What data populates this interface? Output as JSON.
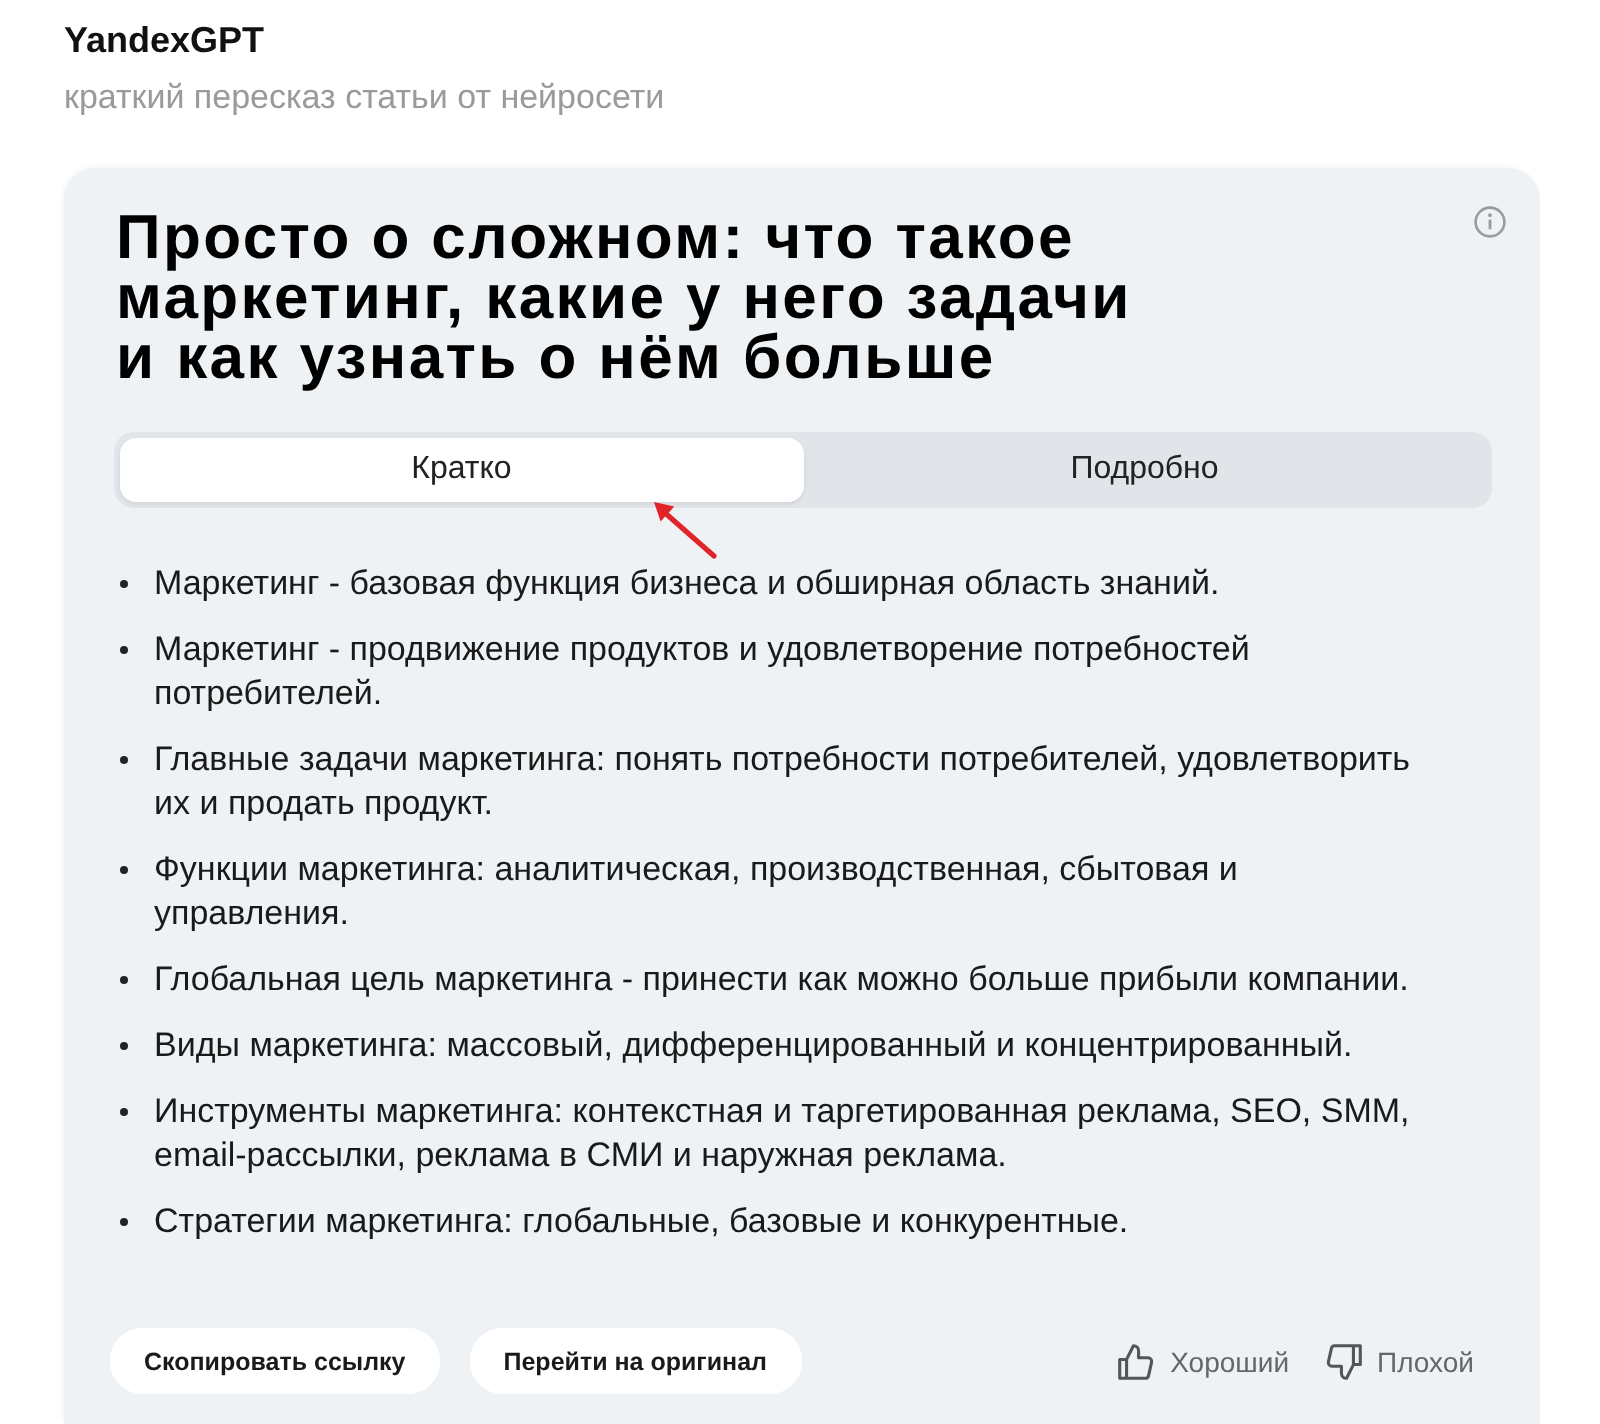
{
  "header": {
    "title": "YandexGPT",
    "subtitle": "краткий пересказ статьи от нейросети"
  },
  "card": {
    "title": "Просто о сложном: что такое маркетинг, какие у него задачи и как узнать о нём больше",
    "tabs": [
      {
        "label": "Кратко",
        "selected": true
      },
      {
        "label": "Подробно",
        "selected": false
      }
    ],
    "summary": [
      "Маркетинг - базовая функция бизнеса и обширная область знаний.",
      "Маркетинг - продвижение продуктов и удовлетворение потребностей потребителей.",
      "Главные задачи маркетинга: понять потребности потребителей, удовлетворить их и продать продукт.",
      "Функции маркетинга: аналитическая, производственная, сбытовая и управления.",
      "Глобальная цель маркетинга - принести как можно больше прибыли компании.",
      "Виды маркетинга: массовый, дифференцированный и концентрированный.",
      "Инструменты маркетинга: контекстная и таргетированная реклама, SEO, SMM, email-рассылки, реклама в СМИ и наружная реклама.",
      "Стратегии маркетинга: глобальные, базовые и конкурентные."
    ],
    "buttons": [
      "Скопировать ссылку",
      "Перейти на оригинал"
    ],
    "ratings": [
      {
        "kind": "like",
        "label": "Хороший"
      },
      {
        "kind": "dislike",
        "label": "Плохой"
      }
    ]
  }
}
